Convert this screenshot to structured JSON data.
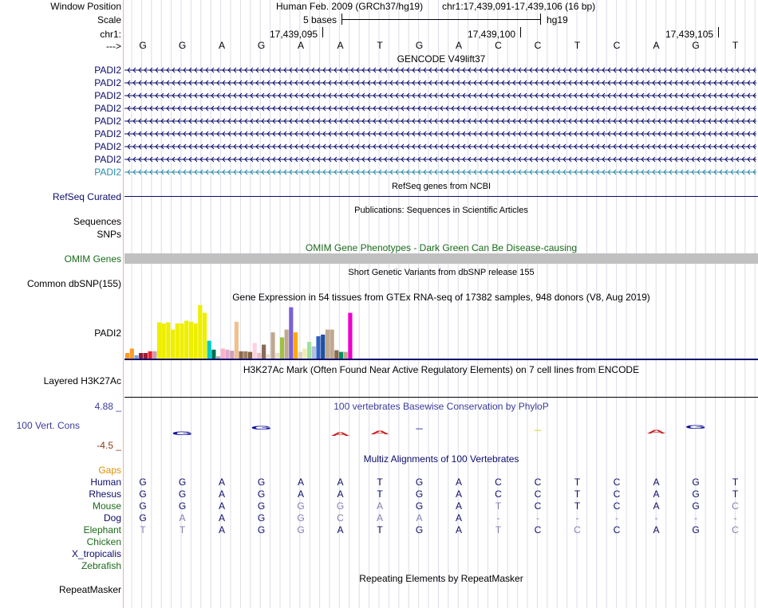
{
  "header": {
    "window_position_label": "Window Position",
    "assembly": "Human Feb. 2009 (GRCh37/hg19)",
    "position": "chr1:17,439,091-17,439,106 (16 bp)",
    "scale_label": "Scale",
    "scale_text": "5 bases",
    "db": "hg19",
    "chrom_label": "chr1:",
    "strand_label": "--->",
    "ticks": [
      "17,439,095",
      "17,439,100",
      "17,439,105"
    ]
  },
  "sequence": [
    "G",
    "G",
    "A",
    "G",
    "A",
    "A",
    "T",
    "G",
    "A",
    "C",
    "C",
    "T",
    "C",
    "A",
    "G",
    "T"
  ],
  "gencode": {
    "title": "GENCODE V49lift37",
    "transcripts": [
      "PADI2",
      "PADI2",
      "PADI2",
      "PADI2",
      "PADI2",
      "PADI2",
      "PADI2",
      "PADI2",
      "PADI2"
    ],
    "colors": [
      "#0d0d6b",
      "#0d0d6b",
      "#0d0d6b",
      "#0d0d6b",
      "#0d0d6b",
      "#0d0d6b",
      "#0d0d6b",
      "#0d0d6b",
      "#2a8aa8"
    ]
  },
  "refseq": {
    "title": "RefSeq genes from NCBI",
    "label": "RefSeq Curated"
  },
  "publications": {
    "title": "Publications: Sequences in Scientific Articles",
    "label1": "Sequences",
    "label2": "SNPs"
  },
  "omim": {
    "title": "OMIM Gene Phenotypes - Dark Green Can Be Disease-causing",
    "label": "OMIM Genes"
  },
  "dbsnp": {
    "title": "Short Genetic Variants from dbSNP release 155",
    "label": "Common dbSNP(155)"
  },
  "gtex": {
    "title": "Gene Expression in 54 tissues from GTEx RNA-seq of 17382 samples, 948 donors (V8, Aug 2019)",
    "label": "PADI2",
    "bars": [
      {
        "v": 0.1,
        "c": "#ff9a2a"
      },
      {
        "v": 0.18,
        "c": "#ff9a2a"
      },
      {
        "v": 0.06,
        "c": "#7aa7d8"
      },
      {
        "v": 0.1,
        "c": "#8b1a3a"
      },
      {
        "v": 0.1,
        "c": "#9a1a3a"
      },
      {
        "v": 0.13,
        "c": "#e8202a"
      },
      {
        "v": 0.13,
        "c": "#c8a0a8"
      },
      {
        "v": 0.65,
        "c": "#eeee00"
      },
      {
        "v": 0.63,
        "c": "#eeee00"
      },
      {
        "v": 0.65,
        "c": "#eeee00"
      },
      {
        "v": 0.52,
        "c": "#eeee00"
      },
      {
        "v": 0.63,
        "c": "#eeee00"
      },
      {
        "v": 0.63,
        "c": "#eeee00"
      },
      {
        "v": 0.68,
        "c": "#eeee00"
      },
      {
        "v": 0.66,
        "c": "#eeee00"
      },
      {
        "v": 0.63,
        "c": "#eeee00"
      },
      {
        "v": 0.96,
        "c": "#eeee00"
      },
      {
        "v": 0.82,
        "c": "#eeee00"
      },
      {
        "v": 0.32,
        "c": "#00cccc"
      },
      {
        "v": 0.16,
        "c": "#007050"
      },
      {
        "v": 0.04,
        "c": "#aaaaaa"
      },
      {
        "v": 0.18,
        "c": "#ffb0c8"
      },
      {
        "v": 0.16,
        "c": "#ddaacc"
      },
      {
        "v": 0.14,
        "c": "#cfa0b8"
      },
      {
        "v": 0.66,
        "c": "#f0c090"
      },
      {
        "v": 0.13,
        "c": "#8a6a50"
      },
      {
        "v": 0.13,
        "c": "#a08060"
      },
      {
        "v": 0.12,
        "c": "#806040"
      },
      {
        "v": 0.28,
        "c": "#ffd0e0"
      },
      {
        "v": 0.1,
        "c": "#e6c0c0"
      },
      {
        "v": 0.25,
        "c": "#8a6a5a"
      },
      {
        "v": 0.08,
        "c": "#e8e0d0"
      },
      {
        "v": 0.47,
        "c": "#c0a890"
      },
      {
        "v": 0.1,
        "c": "#e8e0d0"
      },
      {
        "v": 0.38,
        "c": "#a0c040"
      },
      {
        "v": 0.52,
        "c": "#c0a890"
      },
      {
        "v": 0.92,
        "c": "#7a60d8"
      },
      {
        "v": 0.47,
        "c": "#ffaa00"
      },
      {
        "v": 0.12,
        "c": "#ddd0c0"
      },
      {
        "v": 0.18,
        "c": "#eeeeb0"
      },
      {
        "v": 0.3,
        "c": "#a0e0a0"
      },
      {
        "v": 0.22,
        "c": "#b0c0e0"
      },
      {
        "v": 0.4,
        "c": "#3060c0"
      },
      {
        "v": 0.43,
        "c": "#2050a0"
      },
      {
        "v": 0.52,
        "c": "#c0a890"
      },
      {
        "v": 0.52,
        "c": "#c0a890"
      },
      {
        "v": 0.15,
        "c": "#8a6a50"
      },
      {
        "v": 0.12,
        "c": "#009060"
      },
      {
        "v": 0.12,
        "c": "#c0a890"
      },
      {
        "v": 0.82,
        "c": "#ee00cc"
      }
    ]
  },
  "h3k27ac": {
    "title": "H3K27Ac Mark (Often Found Near Active Regulatory Elements) on 7 cell lines from ENCODE",
    "label": "Layered H3K27Ac"
  },
  "phylop": {
    "title": "100 vertebrates Basewise Conservation by PhyloP",
    "label": "100 Vert. Cons",
    "ymax": "4.88 _",
    "ymin": "-4.5 _"
  },
  "multiz": {
    "title": "Multiz Alignments of 100 Vertebrates",
    "gaps_label": "Gaps",
    "species": [
      {
        "name": "Human",
        "color": "#0d0d6b",
        "bases": [
          "G",
          "G",
          "A",
          "G",
          "A",
          "A",
          "T",
          "G",
          "A",
          "C",
          "C",
          "T",
          "C",
          "A",
          "G",
          "T"
        ],
        "dim": []
      },
      {
        "name": "Rhesus",
        "color": "#0d0d6b",
        "bases": [
          "G",
          "G",
          "A",
          "G",
          "A",
          "A",
          "T",
          "G",
          "A",
          "C",
          "C",
          "T",
          "C",
          "A",
          "G",
          "T"
        ],
        "dim": []
      },
      {
        "name": "Mouse",
        "color": "#1a6a1a",
        "bases": [
          "G",
          "G",
          "A",
          "G",
          "G",
          "G",
          "A",
          "G",
          "A",
          "T",
          "C",
          "T",
          "C",
          "A",
          "G",
          "C"
        ],
        "dim": [
          4,
          5,
          6,
          9,
          15
        ]
      },
      {
        "name": "Dog",
        "color": "#0d0d6b",
        "bases": [
          "G",
          "A",
          "A",
          "G",
          "G",
          "C",
          "A",
          "A",
          "A",
          "-",
          "-",
          "-",
          "-",
          "-",
          "-",
          "-"
        ],
        "dim": [
          1,
          4,
          5,
          6,
          7,
          9,
          10,
          11,
          12,
          13,
          14,
          15
        ]
      },
      {
        "name": "Elephant",
        "color": "#1a6a1a",
        "bases": [
          "T",
          "T",
          "A",
          "G",
          "G",
          "A",
          "T",
          "G",
          "A",
          "T",
          "C",
          "C",
          "C",
          "A",
          "G",
          "C"
        ],
        "dim": [
          0,
          1,
          4,
          9,
          11,
          15
        ]
      },
      {
        "name": "Chicken",
        "color": "#1a6a1a",
        "bases": [],
        "dim": []
      },
      {
        "name": "X_tropicalis",
        "color": "#0d0d6b",
        "bases": [],
        "dim": []
      },
      {
        "name": "Zebrafish",
        "color": "#1a6a1a",
        "bases": [],
        "dim": []
      }
    ]
  },
  "repeatmasker": {
    "title": "Repeating Elements by RepeatMasker",
    "label": "RepeatMasker"
  }
}
